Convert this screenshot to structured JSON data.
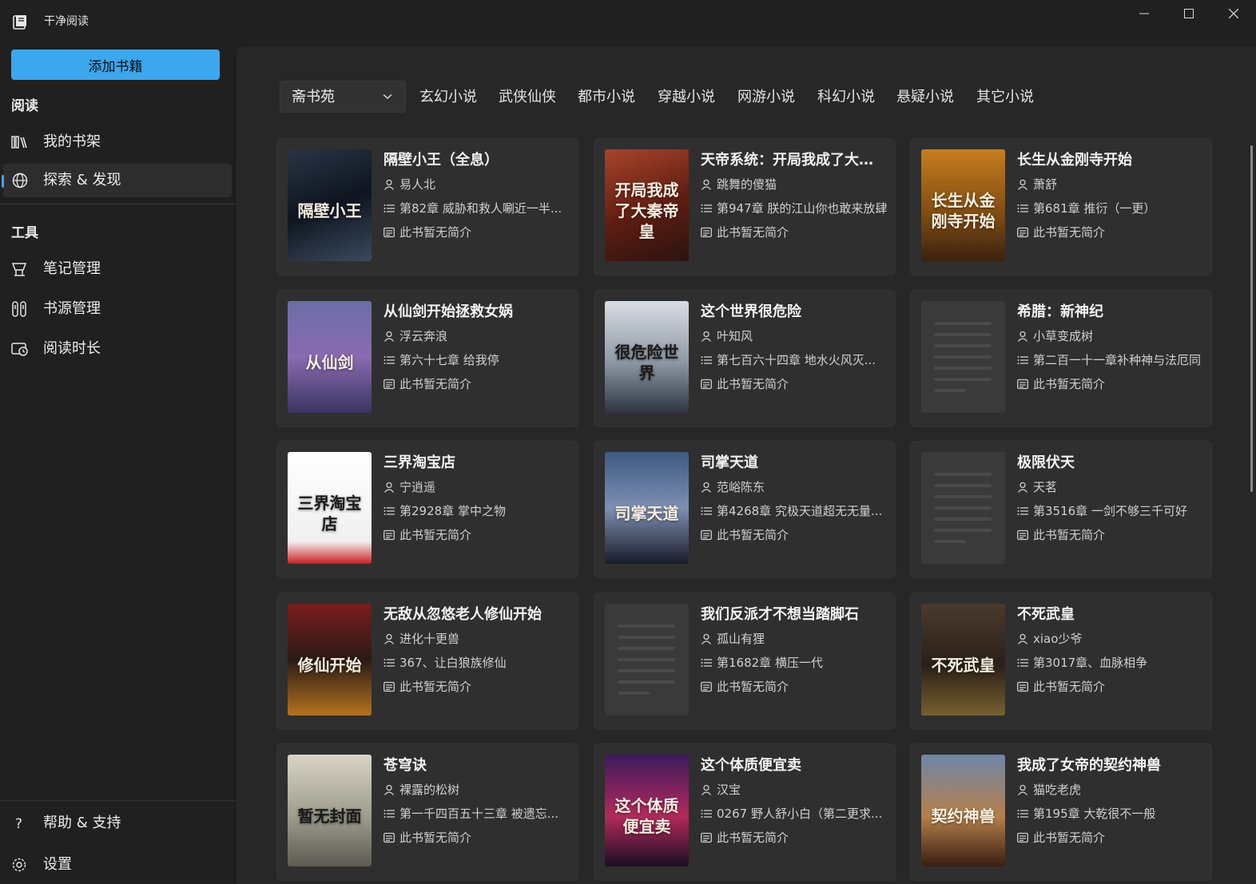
{
  "window": {
    "title": "干净阅读",
    "controls": [
      "minimize-icon",
      "maximize-icon",
      "close-icon"
    ]
  },
  "sidebar": {
    "add_button": "添加书籍",
    "section_reading": "阅读",
    "section_tools": "工具",
    "items": [
      {
        "label": "我的书架",
        "icon": "bookshelf-icon"
      },
      {
        "label": "探索 & 发现",
        "icon": "globe-icon",
        "active": true
      },
      {
        "label": "笔记管理",
        "icon": "notes-icon"
      },
      {
        "label": "书源管理",
        "icon": "source-icon"
      },
      {
        "label": "阅读时长",
        "icon": "reading-time-icon"
      }
    ],
    "help": {
      "label": "帮助 & 支持",
      "icon": "help-icon"
    },
    "settings": {
      "label": "设置",
      "icon": "gear-icon"
    }
  },
  "filter": {
    "source": "斋书苑",
    "categories": [
      "玄幻小说",
      "武侠仙侠",
      "都市小说",
      "穿越小说",
      "网游小说",
      "科幻小说",
      "悬疑小说",
      "其它小说"
    ]
  },
  "books": [
    {
      "title": "隔壁小王（全息）",
      "author": "易人北",
      "chapter": "第82章 威胁和救人唰近一半...",
      "intro": "此书暂无简介",
      "cover_text": "隔壁小王"
    },
    {
      "title": "天帝系统：开局我成了大秦...",
      "author": "跳舞的傻猫",
      "chapter": "第947章 朕的江山你也敢来放肆",
      "intro": "此书暂无简介",
      "cover_text": "开局我成了大秦帝皇"
    },
    {
      "title": "长生从金刚寺开始",
      "author": "萧舒",
      "chapter": "第681章 推衍（一更）",
      "intro": "此书暂无简介",
      "cover_text": "长生从金刚寺开始"
    },
    {
      "title": "从仙剑开始拯救女娲",
      "author": "浮云奔浪",
      "chapter": "第六十七章 给我停",
      "intro": "此书暂无简介",
      "cover_text": "从仙剑"
    },
    {
      "title": "这个世界很危险",
      "author": "叶知风",
      "chapter": "第七百六十四章 地水火风灭...",
      "intro": "此书暂无简介",
      "cover_text": "很危险世界"
    },
    {
      "title": "希腊：新神纪",
      "author": "小草变成树",
      "chapter": "第二百一十一章补种神与法厄同",
      "intro": "此书暂无简介",
      "cover_text": ""
    },
    {
      "title": "三界淘宝店",
      "author": "宁逍遥",
      "chapter": "第2928章 掌中之物",
      "intro": "此书暂无简介",
      "cover_text": "三界淘宝店"
    },
    {
      "title": "司掌天道",
      "author": "范峪陈东",
      "chapter": "第4268章 究极天道超无无量...",
      "intro": "此书暂无简介",
      "cover_text": "司掌天道"
    },
    {
      "title": "极限伏天",
      "author": "天茗",
      "chapter": "第3516章 一剑不够三千可好",
      "intro": "此书暂无简介",
      "cover_text": ""
    },
    {
      "title": "无敌从忽悠老人修仙开始",
      "author": "进化十更兽",
      "chapter": "367、让白狼族修仙",
      "intro": "此书暂无简介",
      "cover_text": "修仙开始"
    },
    {
      "title": "我们反派才不想当踏脚石",
      "author": "孤山有狸",
      "chapter": "第1682章 横压一代",
      "intro": "此书暂无简介",
      "cover_text": ""
    },
    {
      "title": "不死武皇",
      "author": "xiao少爷",
      "chapter": "第3017章、血脉相争",
      "intro": "此书暂无简介",
      "cover_text": "不死武皇"
    },
    {
      "title": "苍穹诀",
      "author": "裸露的松树",
      "chapter": "第一千四百五十三章 被遗忘...",
      "intro": "此书暂无简介",
      "cover_text": "暂无封面"
    },
    {
      "title": "这个体质便宜卖",
      "author": "汉宝",
      "chapter": "0267 野人舒小白（第二更求...",
      "intro": "此书暂无简介",
      "cover_text": "这个体质便宜卖"
    },
    {
      "title": "我成了女帝的契约神兽",
      "author": "猫吃老虎",
      "chapter": "第195章 大乾很不一般",
      "intro": "此书暂无简介",
      "cover_text": "契约神兽"
    }
  ],
  "colors": {
    "accent": "#3ba7ee",
    "background": "#202020",
    "content": "#272727",
    "card": "#2f2f2f"
  }
}
